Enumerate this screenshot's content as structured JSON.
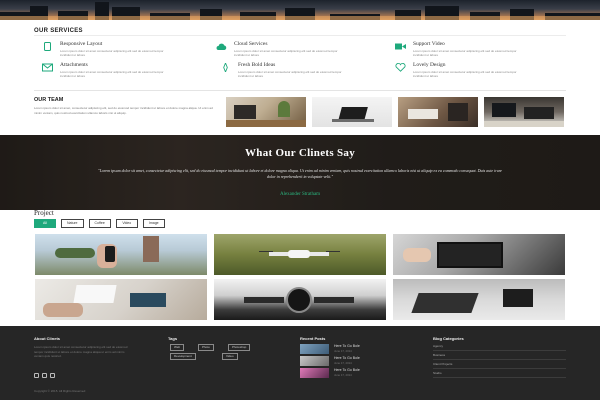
{
  "services": {
    "heading": "OUR SERVICES",
    "items": [
      {
        "icon": "tablet-icon",
        "title": "Responsive Layout",
        "text": "Lorem ipsum dolor sit amet consectetur adipiscing elit sed do eiusmod tempor incididunt ut labore"
      },
      {
        "icon": "cloud-icon",
        "title": "Cloud Services",
        "text": "Lorem ipsum dolor sit amet consectetur adipiscing elit sed do eiusmod tempor incididunt ut labore"
      },
      {
        "icon": "video-camera-icon",
        "title": "Support Video",
        "text": "Lorem ipsum dolor sit amet consectetur adipiscing elit sed do eiusmod tempor incididunt ut labore"
      },
      {
        "icon": "envelope-icon",
        "title": "Attachments",
        "text": "Lorem ipsum dolor sit amet consectetur adipiscing elit sed do eiusmod tempor incididunt ut labore"
      },
      {
        "icon": "compass-icon",
        "title": "Fresh Bold Ideas",
        "text": "Lorem ipsum dolor sit amet consectetur adipiscing elit sed do eiusmod tempor incididunt ut labore"
      },
      {
        "icon": "heart-icon",
        "title": "Lovely Design",
        "text": "Lorem ipsum dolor sit amet consectetur adipiscing elit sed do eiusmod tempor incididunt ut labore"
      }
    ]
  },
  "team": {
    "heading": "OUR TEAM",
    "text": "Lorem ipsum dolor sit amet, consectetur adipiscing elit, sed do eiusmod tempor incididunt ut labore et dolore magna aliqua. Ut enim ad minim veniam, quis nostrud exercitation ullamco laboris nisi ut aliquip."
  },
  "testimonial": {
    "title": "What Our Clinets Say",
    "quote": "\"Lorem ipsum dolor sit amet, consectetur adipiscing elit, sed do eiusmod tempor incididunt ut labore et dolore magna aliqua. Ut enim ad minim veniam, quis nostrud exercitation ullamco laboris nisi ut aliquip ex ea commodo consequat. Duis aute irure dolor in reprehenderit in voluptate velit.\"",
    "author": "Alexander Stratham"
  },
  "project": {
    "heading": "Project",
    "filters": [
      "All",
      "Nature",
      "Coffee",
      "Video",
      "Image"
    ],
    "active_filter": "All"
  },
  "footer": {
    "about_heading": "About Clinets",
    "about_text": "Lorem ipsum dolor sit amet consectetur adipiscing elit sed do eiusmod tempor incididunt ut labore et dolore magna aliqua ut enim ad minim veniam quis nostrud.",
    "copyright": "Copyright © 2015. All Rights Reserved",
    "tags_heading": "Tags",
    "tags": [
      "Web",
      "Photo",
      "Photoshop",
      "Development",
      "Video"
    ],
    "posts_heading": "Recent Posts",
    "posts": [
      {
        "title": "Here To Go Bole",
        "date": "June 17, 2014"
      },
      {
        "title": "Here To Go Bole",
        "date": "June 17, 2014"
      },
      {
        "title": "Here To Go Bole",
        "date": "June 17, 2014"
      }
    ],
    "categories_heading": "Blog Categories",
    "categories": [
      "Agency",
      "Business",
      "Client Projects",
      "Studio"
    ]
  }
}
